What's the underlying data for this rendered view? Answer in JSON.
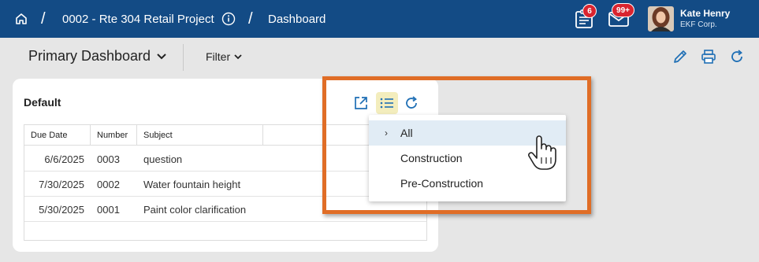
{
  "topbar": {
    "project": "0002 - Rte 304 Retail Project",
    "separator": "/",
    "current_page": "Dashboard",
    "tasks_badge": "6",
    "mail_badge": "99+",
    "user_name": "Kate Henry",
    "user_company": "EKF Corp."
  },
  "toolbar": {
    "dashboard_name": "Primary Dashboard",
    "filter_label": "Filter"
  },
  "widget": {
    "title": "Default",
    "columns": [
      "Due Date",
      "Number",
      "Subject"
    ],
    "rows": [
      {
        "due_date": "6/6/2025",
        "number": "0003",
        "subject": "question"
      },
      {
        "due_date": "7/30/2025",
        "number": "0002",
        "subject": "Water fountain height"
      },
      {
        "due_date": "5/30/2025",
        "number": "0001",
        "subject": "Paint color clarification"
      }
    ]
  },
  "dropdown": {
    "chevron": "›",
    "options": [
      "All",
      "Construction",
      "Pre-Construction"
    ],
    "selected": "All"
  },
  "colors": {
    "topbar": "#134b85",
    "highlight_frame": "#e06d26",
    "selected_option": "#e1ecf5",
    "active_icon_bg": "#f3edbd",
    "icon_blue": "#1f6fb5"
  }
}
